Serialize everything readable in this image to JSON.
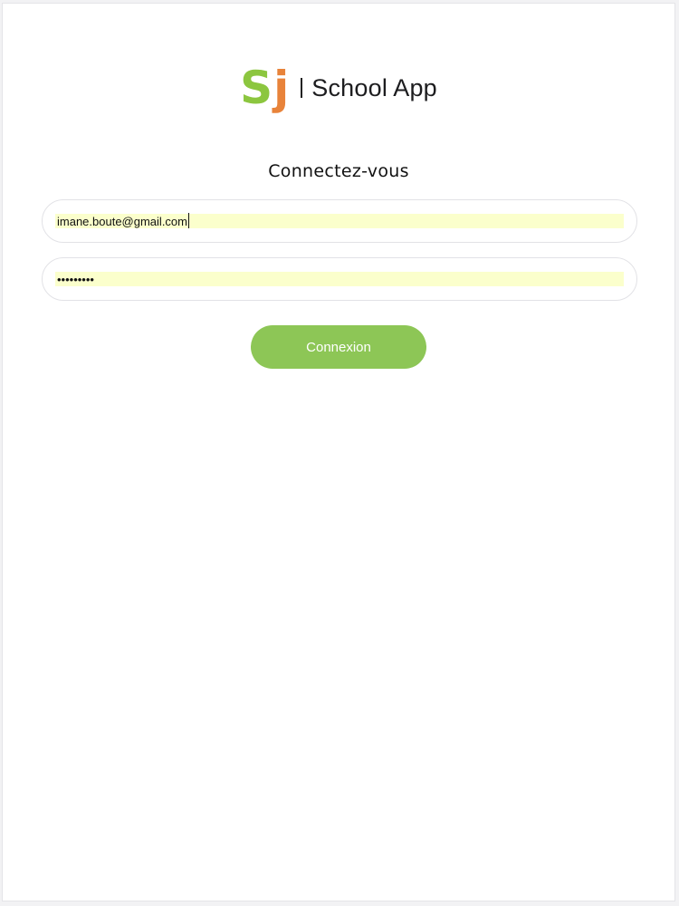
{
  "logo": {
    "mark_s": "S",
    "mark_j": "j",
    "name": "School App",
    "colors": {
      "s": "#8cc63f",
      "j": "#e8833a"
    }
  },
  "login": {
    "heading": "Connectez-vous",
    "email_value": "imane.boute@gmail.com",
    "password_value": "•••••••••",
    "submit_label": "Connexion",
    "accent_color": "#8dc656",
    "autofill_color": "#fbffcc"
  }
}
